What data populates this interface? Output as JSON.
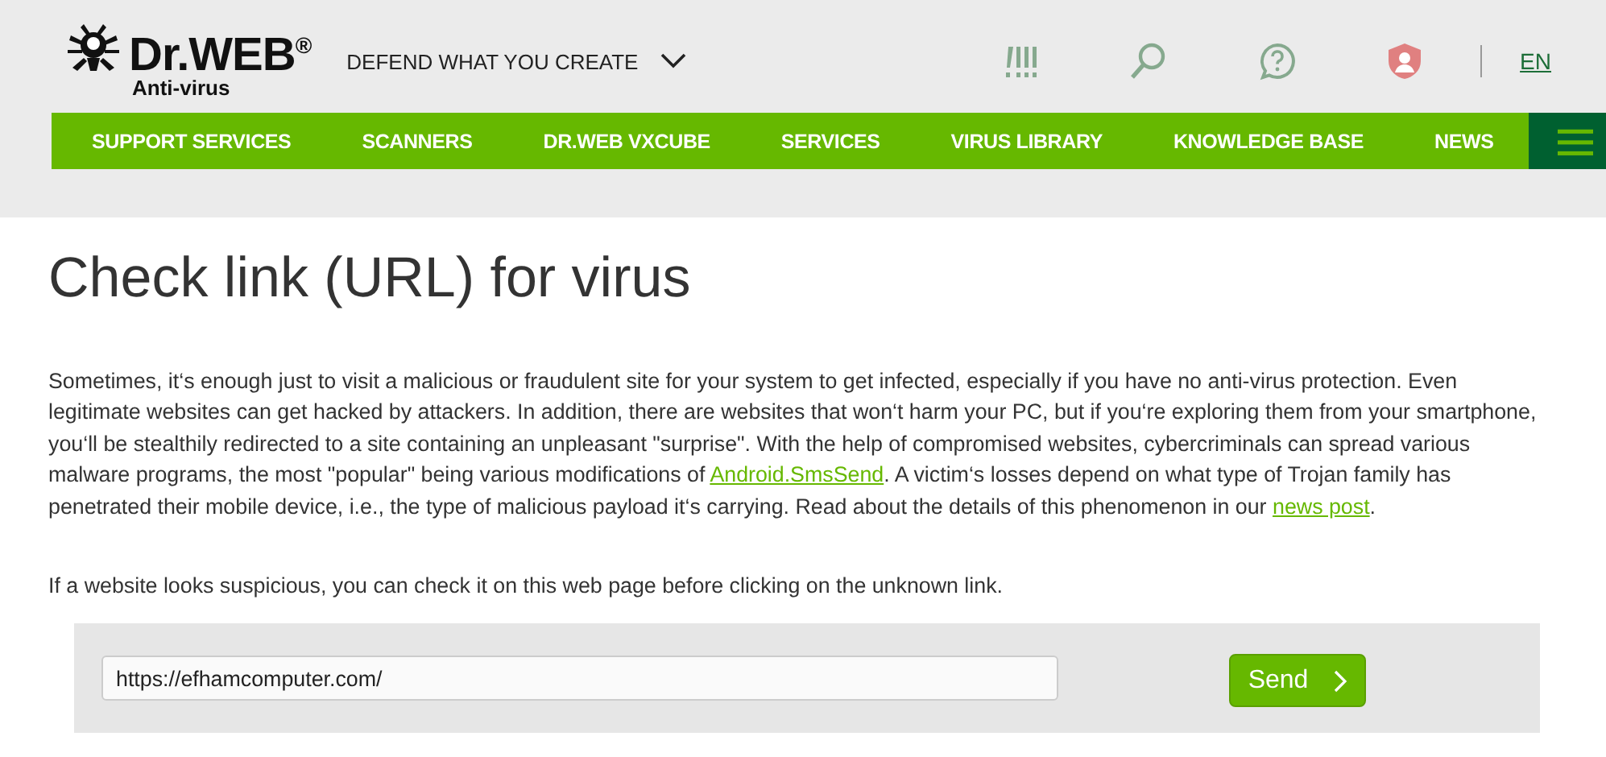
{
  "header": {
    "logo": {
      "name": "Dr.WEB$^{®}$",
      "subtitle": "Anti-virus"
    },
    "slogan": "DEFEND WHAT YOU CREATE",
    "language": "EN"
  },
  "nav": {
    "items": [
      {
        "label": "SUPPORT SERVICES"
      },
      {
        "label": "SCANNERS"
      },
      {
        "label": "DR.WEB VXCUBE"
      },
      {
        "label": "SERVICES"
      },
      {
        "label": "VIRUS LIBRARY"
      },
      {
        "label": "KNOWLEDGE BASE"
      },
      {
        "label": "NEWS"
      }
    ]
  },
  "title": "Check link (URL) for virus",
  "intro": {
    "parts": [
      {
        "kind": "text",
        "text": "Sometimes, it‘s enough just to visit a malicious or fraudulent site for your system to get infected, especially if you have no anti-virus protection. Even legitimate websites can get hacked by attackers. In addition, there are websites that won‘t harm your PC, but if you‘re exploring them from your smartphone, you‘ll be stealthily redirected to a site containing an unpleasant \"surprise\". With the help of compromised websites, cybercriminals can spread various malware programs, the most \"popular\" being various modifications of "
      },
      {
        "kind": "link",
        "text": "Android.SmsSend"
      },
      {
        "kind": "text",
        "text": ". A victim‘s losses depend on what type of Trojan family has penetrated their mobile device, i.e., the type of malicious payload it‘s carrying. Read about the details of this phenomenon in our "
      },
      {
        "kind": "link",
        "text": "news post"
      },
      {
        "kind": "text",
        "text": "."
      }
    ]
  },
  "hint": "If a website looks suspicious, you can check it on this web page before clicking on the unknown link.",
  "form": {
    "url": "https://efhamcomputer.com/",
    "button": "Send"
  }
}
